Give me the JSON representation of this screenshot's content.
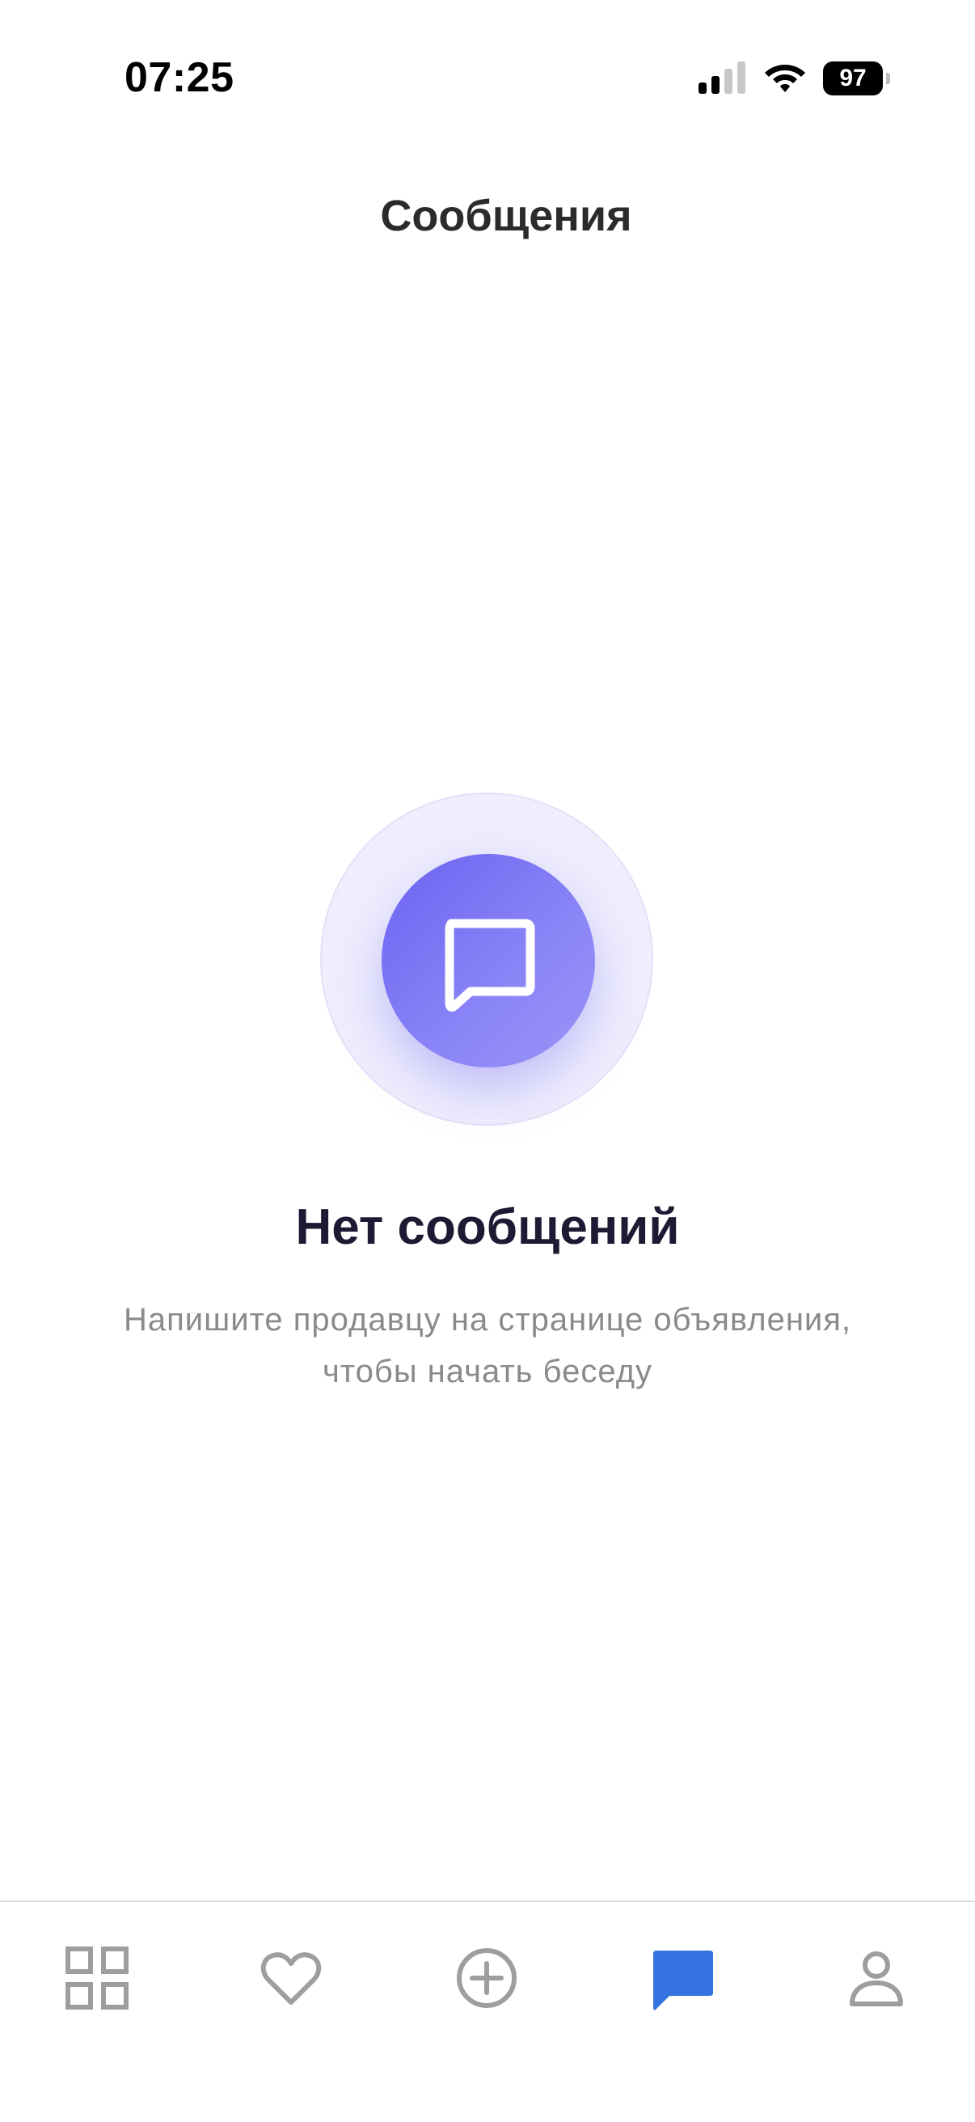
{
  "status_bar": {
    "time": "07:25",
    "battery_level": "97"
  },
  "header": {
    "title": "Сообщения"
  },
  "empty_state": {
    "title": "Нет сообщений",
    "subtitle_line1": "Напишите продавцу на странице объявления,",
    "subtitle_line2": "чтобы начать беседу",
    "icon": "chat-bubble-icon"
  },
  "tab_bar": {
    "active_color": "#3573e0",
    "inactive_color": "#9e9e9e",
    "tabs": [
      {
        "name": "catalog",
        "icon": "grid-icon",
        "active": false
      },
      {
        "name": "favorites",
        "icon": "heart-icon",
        "active": false
      },
      {
        "name": "add",
        "icon": "plus-circle-icon",
        "active": false
      },
      {
        "name": "messages",
        "icon": "chat-bubble-icon",
        "active": true
      },
      {
        "name": "profile",
        "icon": "user-icon",
        "active": false
      }
    ]
  },
  "colors": {
    "accent": "#6b63f2",
    "title_text": "#1c1b33",
    "subtitle_text": "#8a8a8e"
  }
}
